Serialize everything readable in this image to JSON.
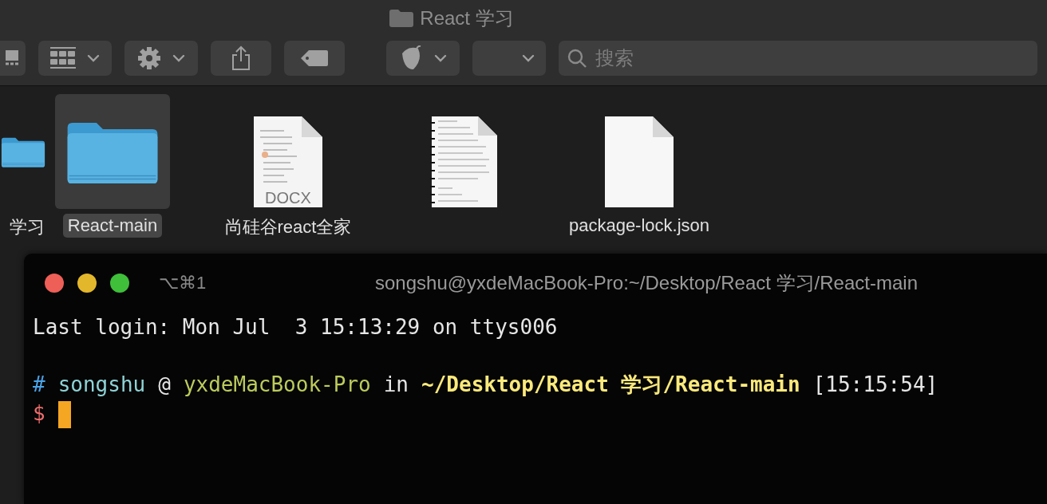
{
  "finder": {
    "title": "React 学习",
    "search": {
      "placeholder": "搜索"
    },
    "files": [
      {
        "kind": "folder",
        "name": "学习",
        "selected": false
      },
      {
        "kind": "folder",
        "name": "React-main",
        "selected": true
      },
      {
        "kind": "docx",
        "name": "尚硅谷react全家",
        "badge": "DOCX",
        "selected": false
      },
      {
        "kind": "notebook",
        "selected": false
      },
      {
        "kind": "blank",
        "name": "package-lock.json",
        "selected": false
      }
    ]
  },
  "terminal": {
    "shortcut": "⌥⌘1",
    "title": "songshu@yxdeMacBook-Pro:~/Desktop/React 学习/React-main",
    "login_line": "Last login: Mon Jul  3 15:13:29 on ttys006",
    "prompt_segments": [
      {
        "text": "#",
        "color": "#4aa3e8",
        "bold": false
      },
      {
        "text": "songshu",
        "color": "#8fd3d6",
        "bold": false
      },
      {
        "text": "@",
        "color": "#e6e6e6",
        "bold": false
      },
      {
        "text": "yxdeMacBook-Pro",
        "color": "#bccb5c",
        "bold": false
      },
      {
        "text": "in",
        "color": "#e6e6e6",
        "bold": false
      },
      {
        "text": "~/Desktop/React 学习/React-main",
        "color": "#fbe97c",
        "bold": true
      },
      {
        "text": "[15:15:54]",
        "color": "#e6e6e6",
        "bold": false
      }
    ],
    "input_prompt": "$",
    "cursor": true
  }
}
